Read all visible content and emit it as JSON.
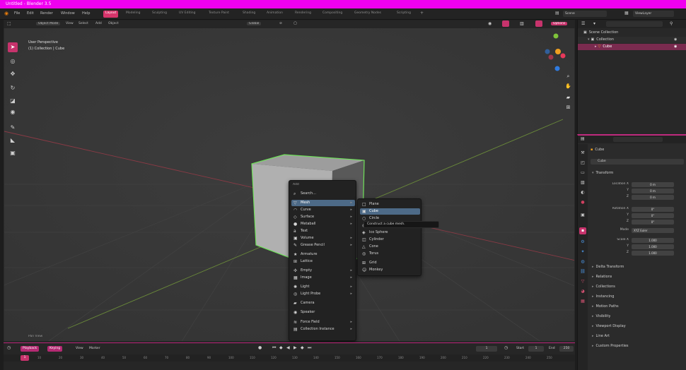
{
  "window": {
    "title": "Untitled - Blender 3.5"
  },
  "menubar": {
    "items": [
      "File",
      "Edit",
      "Render",
      "Window",
      "Help"
    ],
    "workspaces": [
      "Layout",
      "Modeling",
      "Sculpting",
      "UV Editing",
      "Texture Paint",
      "Shading",
      "Animation",
      "Rendering",
      "Compositing",
      "Geometry Nodes",
      "Scripting"
    ],
    "scene": "Scene",
    "view_layer": "ViewLayer"
  },
  "viewport_header": {
    "mode": "Object Mode",
    "menus": [
      "View",
      "Select",
      "Add",
      "Object"
    ],
    "transform": "Global",
    "options": "Options"
  },
  "viewport": {
    "view_name": "User Perspective",
    "collection_path": "(1) Collection | Cube",
    "status_left": "Pan View",
    "accent": "#c7336c",
    "selection_outline": "#6fe25a"
  },
  "tools": [
    "cursor",
    "move",
    "rotate",
    "scale",
    "transform",
    "annotate",
    "measure",
    "add-cube"
  ],
  "add_menu": {
    "title": "Add",
    "search": "Search...",
    "items": [
      {
        "label": "Mesh",
        "icon": "▽",
        "sub": true
      },
      {
        "label": "Curve",
        "icon": "◠",
        "sub": true
      },
      {
        "label": "Surface",
        "icon": "◇",
        "sub": true
      },
      {
        "label": "Metaball",
        "icon": "●",
        "sub": true
      },
      {
        "label": "Text",
        "icon": "a",
        "sub": false
      },
      {
        "label": "Volume",
        "icon": "▣",
        "sub": true
      },
      {
        "label": "Grease Pencil",
        "icon": "✎",
        "sub": true
      },
      {
        "label": "Armature",
        "icon": "★",
        "sub": false
      },
      {
        "label": "Lattice",
        "icon": "⊞",
        "sub": false
      },
      {
        "label": "Empty",
        "icon": "✣",
        "sub": true
      },
      {
        "label": "Image",
        "icon": "▦",
        "sub": true
      },
      {
        "label": "Light",
        "icon": "✺",
        "sub": true
      },
      {
        "label": "Light Probe",
        "icon": "◎",
        "sub": true
      },
      {
        "label": "Camera",
        "icon": "▰",
        "sub": false
      },
      {
        "label": "Speaker",
        "icon": "◉",
        "sub": false
      },
      {
        "label": "Force Field",
        "icon": "≋",
        "sub": true
      },
      {
        "label": "Collection Instance",
        "icon": "▤",
        "sub": true
      }
    ]
  },
  "mesh_submenu": {
    "items": [
      {
        "label": "Plane",
        "icon": "□"
      },
      {
        "label": "Cube",
        "icon": "▣"
      },
      {
        "label": "Circle",
        "icon": "○"
      },
      {
        "label": "UV Sphere",
        "icon": "◍"
      },
      {
        "label": "Ico Sphere",
        "icon": "◈"
      },
      {
        "label": "Cylinder",
        "icon": "◫"
      },
      {
        "label": "Cone",
        "icon": "△"
      },
      {
        "label": "Torus",
        "icon": "◎"
      },
      {
        "label": "Grid",
        "icon": "⊞"
      },
      {
        "label": "Monkey",
        "icon": "☺"
      }
    ],
    "tooltip": "Construct a cube mesh."
  },
  "outliner": {
    "rows": [
      "Scene Collection",
      "Collection",
      "Cube"
    ]
  },
  "properties": {
    "object_name": "Cube",
    "data_name": "Cube",
    "section": "Transform",
    "location": {
      "label": "Location X",
      "values": [
        "0 m",
        "0 m",
        "0 m"
      ]
    },
    "rotation": {
      "label": "Rotation X",
      "values": [
        "0°",
        "0°",
        "0°"
      ]
    },
    "mode_label": "Mode",
    "mode_value": "XYZ Euler",
    "scale": {
      "label": "Scale X",
      "values": [
        "1.000",
        "1.000",
        "1.000"
      ]
    },
    "axis": [
      "Y",
      "Z"
    ],
    "collapsed": [
      "Delta Transform",
      "Relations",
      "Collections",
      "Instancing",
      "Motion Paths",
      "Visibility",
      "Viewport Display",
      "Line Art",
      "Custom Properties"
    ]
  },
  "timeline": {
    "playback": "Playback",
    "keying": "Keying",
    "view": "View",
    "marker": "Marker",
    "start_label": "Start",
    "start": "1",
    "end_label": "End",
    "end": "250",
    "current": "1",
    "ticks": [
      "10",
      "20",
      "30",
      "40",
      "50",
      "60",
      "70",
      "80",
      "90",
      "100",
      "110",
      "120",
      "130",
      "140",
      "150",
      "160",
      "170",
      "180",
      "190",
      "200",
      "210",
      "220",
      "230",
      "240",
      "250"
    ]
  }
}
